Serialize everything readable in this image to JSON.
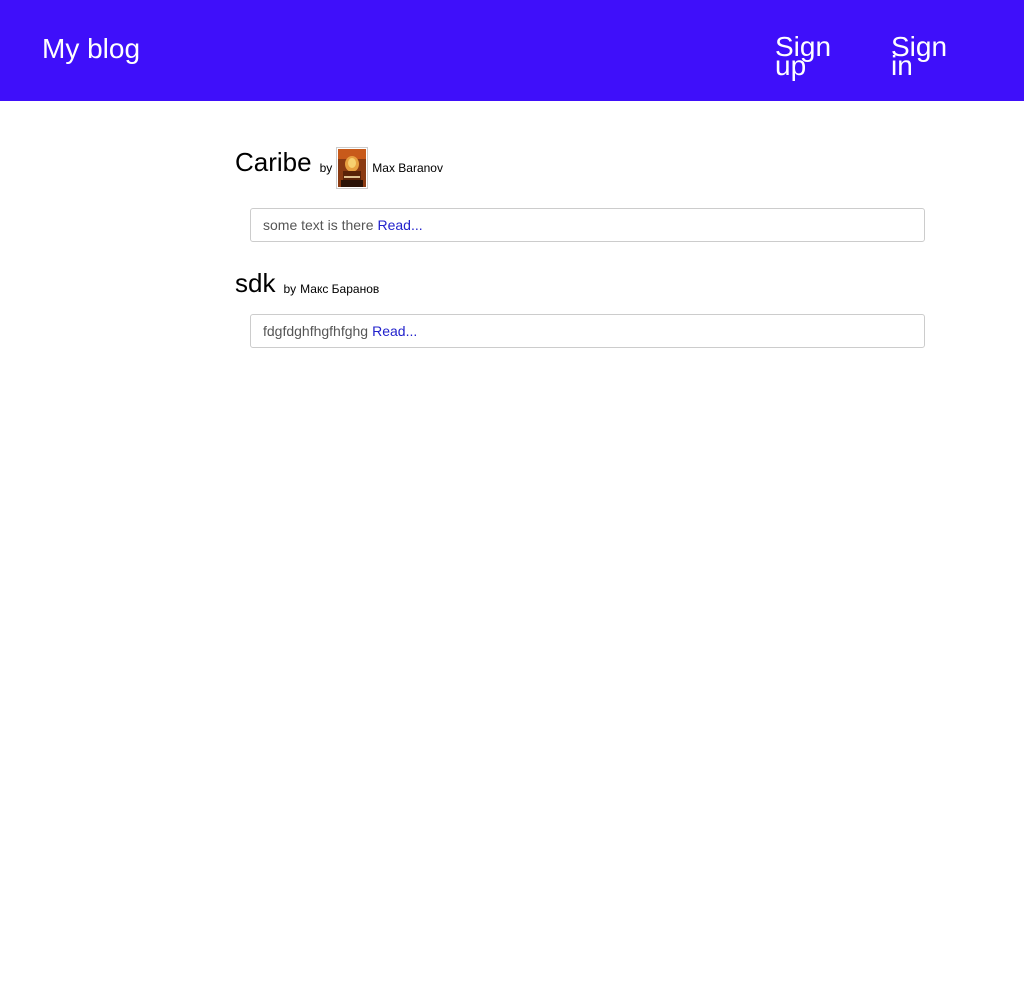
{
  "header": {
    "brand": "My blog",
    "signup_label": "Sign up",
    "signin_label": "Sign in",
    "background_color": "#3f0ffa"
  },
  "posts": [
    {
      "title": "Caribe",
      "by_label": "by",
      "author": "Max Baranov",
      "has_avatar": true,
      "excerpt": "some text is there",
      "read_label": "Read..."
    },
    {
      "title": "sdk",
      "by_label": "by",
      "author": "Макс Баранов",
      "has_avatar": false,
      "excerpt": "fdgfdghfhgfhfghg",
      "read_label": "Read..."
    }
  ],
  "colors": {
    "link": "#2222cc",
    "excerpt_text": "#555555",
    "border": "#cccccc"
  }
}
